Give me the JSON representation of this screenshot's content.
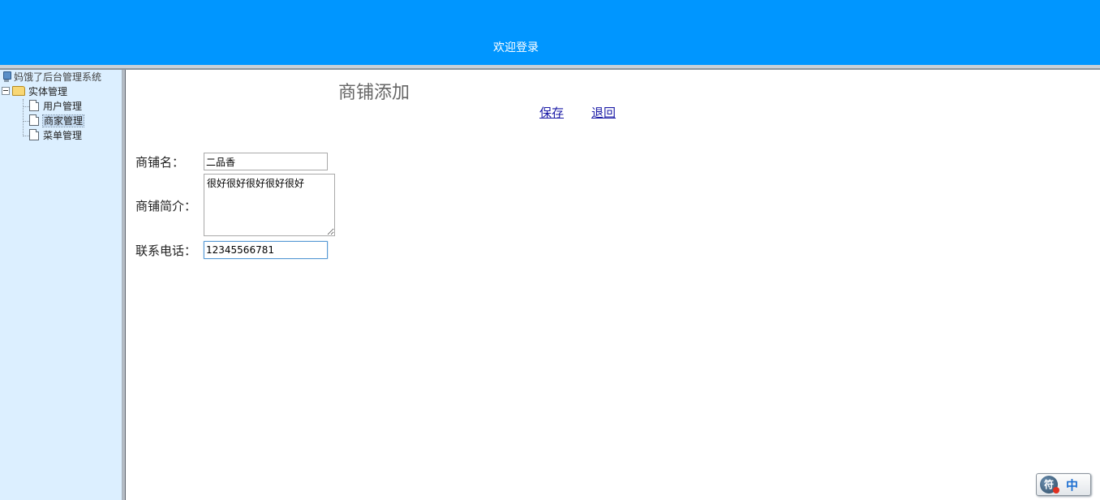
{
  "header": {
    "title": "欢迎登录"
  },
  "sidebar": {
    "root_label": "妈饿了后台管理系统",
    "folder_label": "实体管理",
    "items": [
      {
        "label": "用户管理"
      },
      {
        "label": "商家管理",
        "selected": true
      },
      {
        "label": "菜单管理"
      }
    ]
  },
  "main": {
    "page_title": "商铺添加",
    "save_label": "保存",
    "back_label": "退回",
    "form": {
      "name_label": "商铺名：",
      "name_value": "二品香",
      "desc_label": "商铺简介：",
      "desc_value": "很好很好很好很好很好",
      "phone_label": "联系电话：",
      "phone_value": "12345566781"
    }
  },
  "ime": {
    "logo_char": "符",
    "mode_char": "中"
  },
  "colors": {
    "header_bg": "#0096ff",
    "sidebar_bg": "#dcefff",
    "link": "#1a1aa6"
  }
}
